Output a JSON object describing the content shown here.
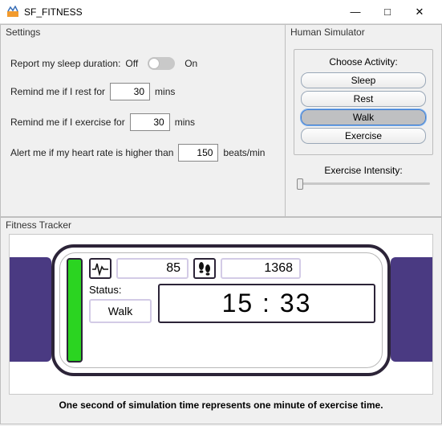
{
  "window": {
    "title": "SF_FITNESS",
    "minimize": "—",
    "maximize": "□",
    "close": "✕"
  },
  "settings": {
    "title": "Settings",
    "sleep_label": "Report my sleep duration:",
    "off": "Off",
    "on": "On",
    "rest_label": "Remind me if I rest for",
    "rest_value": "30",
    "rest_unit": "mins",
    "exercise_label": "Remind me if I exercise for",
    "exercise_value": "30",
    "exercise_unit": "mins",
    "hr_label": "Alert me if my heart rate is higher than",
    "hr_value": "150",
    "hr_unit": "beats/min"
  },
  "sim": {
    "title": "Human Simulator",
    "group_title": "Choose Activity:",
    "activities": {
      "sleep": "Sleep",
      "rest": "Rest",
      "walk": "Walk",
      "exercise": "Exercise"
    },
    "intensity_label": "Exercise Intensity:"
  },
  "tracker": {
    "title": "Fitness Tracker",
    "hr": "85",
    "steps": "1368",
    "status_label": "Status:",
    "status_value": "Walk",
    "time": "15 : 33",
    "caption": "One second of simulation time represents one minute of exercise time."
  }
}
